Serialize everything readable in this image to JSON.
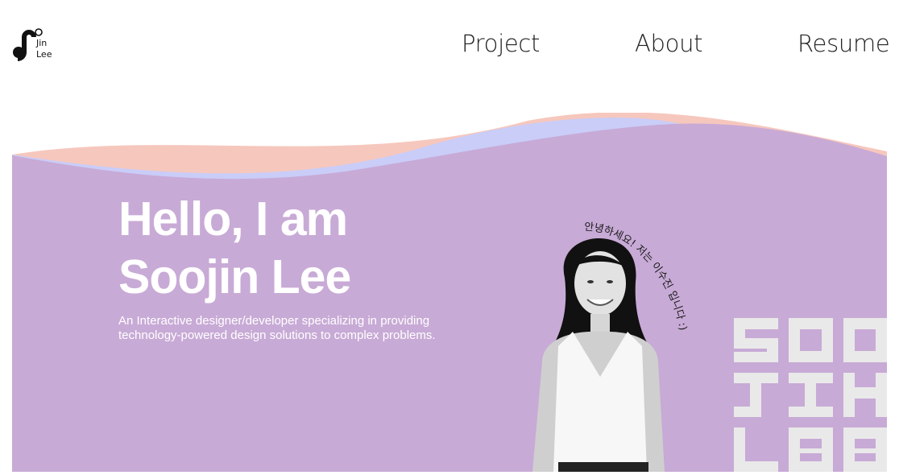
{
  "logo": {
    "alt": "Soojin Lee logo",
    "text_lines": [
      "o",
      "Jin",
      "Lee"
    ]
  },
  "nav": {
    "items": [
      "Project",
      "About",
      "Resume"
    ]
  },
  "hero": {
    "title_line1": "Hello, I am",
    "title_line2": "Soojin Lee",
    "description": "An Interactive designer/developer specializing in providing technology-powered design solutions to complex problems.",
    "greeting_korean": "안녕하세요! 저는 이수진 입니다 :)",
    "monogram_text": "SOO JIN LEE"
  },
  "colors": {
    "hero_purple": "#c8aad6",
    "wave_blue": "#c9cdf8",
    "wave_peach": "#f6c7bd",
    "text_white": "#ffffff",
    "monogram_gray": "#e9e9e9"
  }
}
